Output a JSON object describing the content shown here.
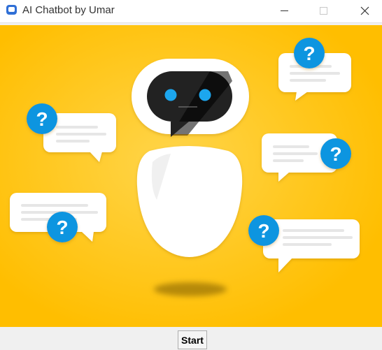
{
  "window": {
    "title": "AI Chatbot by Umar",
    "icon": "chat-bubble-icon",
    "controls": [
      "minimize-icon",
      "maximize-icon",
      "close-icon"
    ]
  },
  "banner": {
    "description_icon": "chatbot-illustration",
    "background_color": "#ffc200",
    "question_mark": "?",
    "accent_color": "#0d95e0"
  },
  "actions": {
    "start_label": "Start"
  }
}
